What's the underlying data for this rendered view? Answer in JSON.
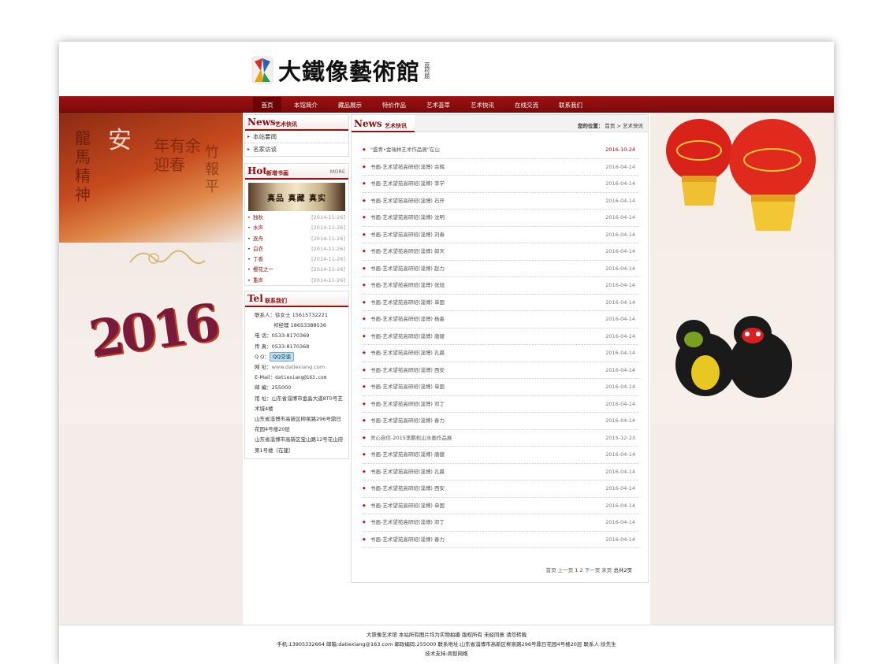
{
  "header": {
    "logo_text": "大鐵像藝術館",
    "logo_seal": "蓝村题"
  },
  "nav": {
    "items": [
      "首页",
      "本馆简介",
      "藏品展示",
      "特价作品",
      "艺术荟萃",
      "艺术快讯",
      "在线交流",
      "联系我们"
    ]
  },
  "left_art": {
    "chars": [
      "龍",
      "馬",
      "精",
      "神",
      "安",
      "年",
      "有",
      "余",
      "迎",
      "春",
      "竹",
      "報",
      "平"
    ],
    "year": "2016"
  },
  "sidebar": {
    "news": {
      "en": "News",
      "cn": "艺术快讯",
      "links": [
        "本站要闻",
        "名家访谈"
      ]
    },
    "hot": {
      "en": "Hot",
      "cn": "新增书画",
      "more": "MORE",
      "banner": "真品  真藏  真实",
      "items": [
        {
          "title": "独秋",
          "date": "[2014-11-26]"
        },
        {
          "title": "水声",
          "date": "[2014-11-26]"
        },
        {
          "title": "逐舟",
          "date": "[2014-11-26]"
        },
        {
          "title": "白衣",
          "date": "[2014-11-26]"
        },
        {
          "title": "丁香",
          "date": "[2014-11-26]"
        },
        {
          "title": "樱花之一",
          "date": "[2014-11-26]"
        },
        {
          "title": "重声",
          "date": "[2014-11-26]"
        }
      ]
    },
    "tel": {
      "en": "Tel",
      "cn": "联系我们",
      "contact_label": "联系人：",
      "contact1": "徐女士  15615732221",
      "contact2": "祁经理  18653388536",
      "phone_label": "电  话：",
      "phone": "0533-8170369",
      "fax_label": "传  真：",
      "fax": "0533-8170368",
      "qq_label": "Q Q：",
      "qq_button": "QQ交谈",
      "web_label": "网  址：",
      "web": "www.datiexiang.com",
      "email_label": "E-Mail：",
      "email": "datiexiang@163.com",
      "post_label": "邮  编：",
      "post": "255000",
      "addr_label": "馆  址：",
      "addr1": "山东省淄博市金晶大道8T0号艺术城4楼",
      "addr2": "山东省淄博市高新区柳泉路296号鼎日花园4号楼20层",
      "addr3": "山东省淄博市高新区宝山路12号花山府第1号楼（在建）"
    }
  },
  "main": {
    "en": "News",
    "cn": "艺术快讯",
    "crumb_label": "您的位置：",
    "crumb_home": "首页",
    "crumb_sep": ">",
    "crumb_current": "艺术快讯",
    "rows": [
      {
        "title": "\"盛青•金瑞林艺术作品展\"在山",
        "date": "2016-10-24"
      },
      {
        "title": "书画-艺术望苑高研班(淄博) 余辉",
        "date": "2016-04-14"
      },
      {
        "title": "书画-艺术望苑高研班(淄博) 李学",
        "date": "2016-04-14"
      },
      {
        "title": "书画-艺术望苑高研班(淄博) 石开",
        "date": "2016-04-14"
      },
      {
        "title": "书画-艺术望苑高研班(淄博) 沈明",
        "date": "2016-04-14"
      },
      {
        "title": "书画-艺术望苑高研班(淄博) 刘春",
        "date": "2016-04-14"
      },
      {
        "title": "书画-艺术望苑高研班(淄博) 郎天",
        "date": "2016-04-14"
      },
      {
        "title": "书画-艺术望苑高研班(淄博) 赵力",
        "date": "2016-04-14"
      },
      {
        "title": "书画-艺术望苑高研班(淄博) 张旭",
        "date": "2016-04-14"
      },
      {
        "title": "书画-艺术望苑高研班(淄博) 单国",
        "date": "2016-04-14"
      },
      {
        "title": "书画-艺术望苑高研班(淄博) 杨墨",
        "date": "2016-04-14"
      },
      {
        "title": "书画-艺术望苑高研班(淄博) 唐健",
        "date": "2016-04-14"
      },
      {
        "title": "书画-艺术望苑高研班(淄博) 孔晨",
        "date": "2016-04-14"
      },
      {
        "title": "书画-艺术望苑高研班(淄博) 西安",
        "date": "2016-04-14"
      },
      {
        "title": "书画-艺术望苑高研班(淄博) 单国",
        "date": "2016-04-14"
      },
      {
        "title": "书画-艺术望苑高研班(淄博) 邓丁",
        "date": "2016-04-14"
      },
      {
        "title": "书画-艺术望苑高研班(淄博) 春力",
        "date": "2016-04-14"
      },
      {
        "title": "灵心自信-2015李鹏松山水画作品展",
        "date": "2015-12-23"
      },
      {
        "title": "书画-艺术望苑高研班(淄博) 唐健",
        "date": "2016-04-14"
      },
      {
        "title": "书画-艺术望苑高研班(淄博) 孔晨",
        "date": "2016-04-14"
      },
      {
        "title": "书画-艺术望苑高研班(淄博) 西安",
        "date": "2016-04-14"
      },
      {
        "title": "书画-艺术望苑高研班(淄博) 单国",
        "date": "2016-04-14"
      },
      {
        "title": "书画-艺术望苑高研班(淄博) 邓丁",
        "date": "2016-04-14"
      },
      {
        "title": "书画-艺术望苑高研班(淄博) 春力",
        "date": "2016-04-14"
      }
    ],
    "pager": {
      "first": "首页",
      "prev": "上一页",
      "page1": "1",
      "page2": "2",
      "next": "下一页",
      "last": "末页",
      "total": "总共2页"
    }
  },
  "footer": {
    "line1": "大铁像艺术馆  本站所有图片均为实物拍摄  版权所有 未经同意 请勿转载",
    "line2": "手机:13905332664  邮箱:datiexiang@163.com  邮政编码:255000  联系地址:山东省淄博市高新区柳泉路296号鼎日花园4号楼20层  联系人:徐先生",
    "line3": "技术支持:商智网络"
  },
  "colors": {
    "nav_red": "#9a1111",
    "accent_red": "#8a0d0d",
    "date_highlight": "#cc0000"
  }
}
